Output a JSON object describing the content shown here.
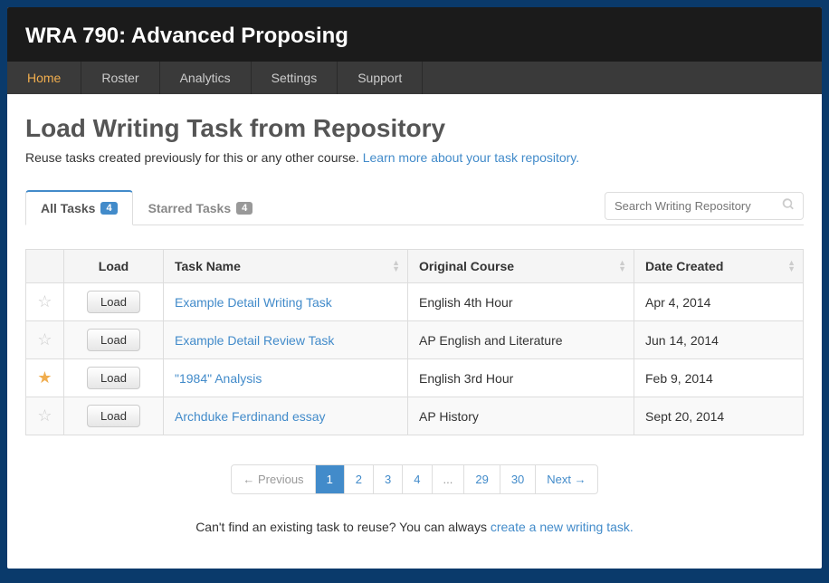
{
  "header": {
    "title": "WRA 790: Advanced Proposing"
  },
  "nav": {
    "items": [
      "Home",
      "Roster",
      "Analytics",
      "Settings",
      "Support"
    ],
    "active": 0
  },
  "page": {
    "title": "Load Writing Task from Repository",
    "subtitle_text": "Reuse tasks created previously for this or any other course. ",
    "subtitle_link": "Learn more about your task repository."
  },
  "tabs": {
    "all": {
      "label": "All Tasks",
      "count": "4"
    },
    "starred": {
      "label": "Starred Tasks",
      "count": "4"
    }
  },
  "search": {
    "placeholder": "Search Writing Repository"
  },
  "table": {
    "headers": {
      "load": "Load",
      "name": "Task Name",
      "course": "Original Course",
      "date": "Date Created"
    },
    "load_button": "Load",
    "rows": [
      {
        "starred": false,
        "name": "Example Detail Writing Task",
        "course": "English 4th Hour",
        "date": "Apr 4, 2014"
      },
      {
        "starred": false,
        "name": "Example Detail Review Task",
        "course": "AP English and Literature",
        "date": "Jun 14, 2014"
      },
      {
        "starred": true,
        "name": "\"1984\" Analysis",
        "course": "English 3rd Hour",
        "date": "Feb 9, 2014"
      },
      {
        "starred": false,
        "name": "Archduke Ferdinand essay",
        "course": "AP History",
        "date": "Sept 20, 2014"
      }
    ]
  },
  "pagination": {
    "prev": "← Previous",
    "pages": [
      "1",
      "2",
      "3",
      "4",
      "...",
      "29",
      "30"
    ],
    "next": "Next →",
    "active": 0
  },
  "footer": {
    "text": "Can't find an existing task to reuse? You can always ",
    "link": "create a new writing task."
  }
}
